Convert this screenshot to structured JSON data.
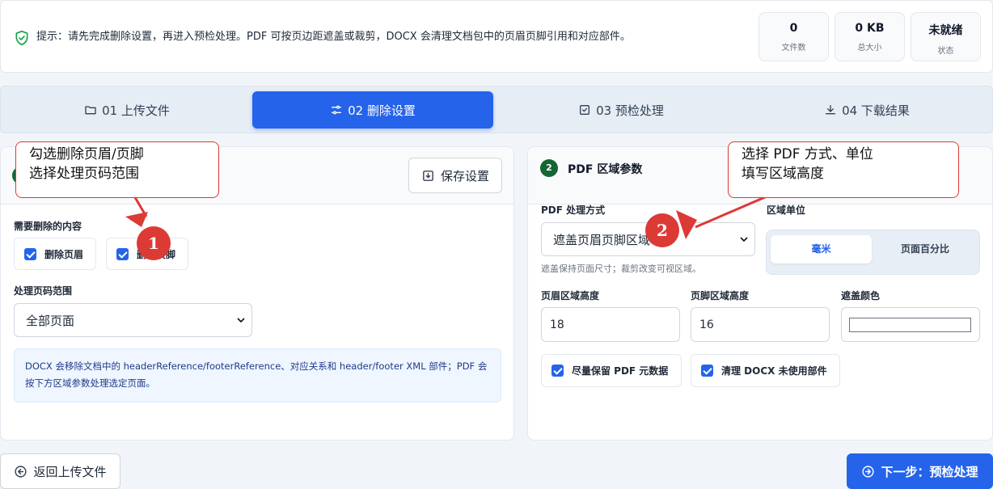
{
  "notice": {
    "text": "提示：请先完成删除设置，再进入预检处理。PDF 可按页边距遮盖或裁剪，DOCX 会清理文档包中的页眉页脚引用和对应部件。"
  },
  "stats": [
    {
      "value": "0",
      "label": "文件数"
    },
    {
      "value": "0 KB",
      "label": "总大小"
    },
    {
      "value": "未就绪",
      "label": "状态"
    }
  ],
  "steps": [
    {
      "label": "01 上传文件",
      "icon": "folder-icon"
    },
    {
      "label": "02 删除设置",
      "icon": "sliders-icon"
    },
    {
      "label": "03 预检处理",
      "icon": "check-square-icon"
    },
    {
      "label": "04 下载结果",
      "icon": "download-icon"
    }
  ],
  "left": {
    "save_label": "保存设置",
    "content_label": "需要删除的内容",
    "checks": [
      "删除页眉",
      "删除页脚"
    ],
    "range_label": "处理页码范围",
    "range_value": "全部页面",
    "info": "DOCX 会移除文档中的 headerReference/footerReference、对应关系和 header/footer XML 部件；PDF 会按下方区域参数处理选定页面。"
  },
  "right": {
    "badge": "2",
    "title": "PDF 区域参数",
    "mode_label": "PDF 处理方式",
    "mode_value": "遮盖页眉页脚区域",
    "mode_hint": "遮盖保持页面尺寸；裁剪改变可视区域。",
    "unit_label": "区域单位",
    "unit_options": [
      "毫米",
      "页面百分比"
    ],
    "header_h_label": "页眉区域高度",
    "header_h_value": "18",
    "footer_h_label": "页脚区域高度",
    "footer_h_value": "16",
    "color_label": "遮盖颜色",
    "color_value": "#ffffff",
    "checks": [
      "尽量保留 PDF 元数据",
      "清理 DOCX 未使用部件"
    ]
  },
  "footer": {
    "back_label": "返回上传文件",
    "next_label": "下一步：预检处理"
  },
  "annotations": [
    {
      "number": "1",
      "line1": "勾选删除页眉/页脚",
      "line2": "选择处理页码范围"
    },
    {
      "number": "2",
      "line1": "选择 PDF 方式、单位",
      "line2": "填写区域高度"
    }
  ],
  "colors": {
    "primary": "#2563eb",
    "annotation_red": "#dc3a35",
    "badge_green": "#166534",
    "info_bg": "#eff6ff"
  }
}
